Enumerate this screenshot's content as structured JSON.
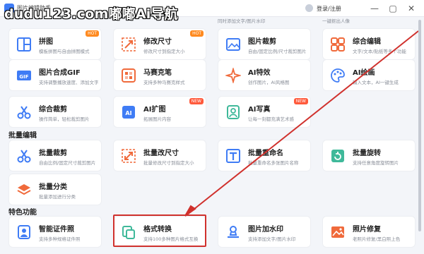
{
  "titlebar": {
    "app_title": "图片编辑助手",
    "watermark": "dudu123.com嘟嘟Ai导航",
    "login": "登录/注册",
    "minimize": "—",
    "maximize": "▢",
    "close": "✕"
  },
  "top_cut_descs": [
    "",
    "",
    "同时添加文字/图片水印",
    "一键抠出人像"
  ],
  "sections": {
    "batch": "批量编辑",
    "special": "特色功能"
  },
  "tools": {
    "pintu": {
      "title": "拼图",
      "desc": "模板拼图与自由拼图模式",
      "badge": "HOT"
    },
    "resize": {
      "title": "修改尺寸",
      "desc": "修改尺寸到指定大小",
      "badge": "HOT"
    },
    "crop": {
      "title": "图片裁剪",
      "desc": "自由/固定比例/尺寸裁剪图片"
    },
    "composite": {
      "title": "综合编辑",
      "desc": "文字/文本/贴纸等多个功能"
    },
    "gif": {
      "title": "图片合成GIF",
      "desc": "支持调整播放速度、添加文字"
    },
    "mosaic": {
      "title": "马赛克笔",
      "desc": "支持多种马赛克样式"
    },
    "ai_effect": {
      "title": "AI特效",
      "desc": "创作图片，AI风格图"
    },
    "ai_paint": {
      "title": "AI绘画",
      "desc": "输入文本，AI一键生成"
    },
    "comp_cut": {
      "title": "综合裁剪",
      "desc": "操作简单，轻松裁剪图片"
    },
    "ai_expand": {
      "title": "AI扩图",
      "desc": "拓展图片内容",
      "badge": "NEW"
    },
    "ai_portrait": {
      "title": "AI写真",
      "desc": "让每一刻都充满艺术感",
      "badge": "NEW"
    },
    "batch_crop": {
      "title": "批量裁剪",
      "desc": "自由比例/固定尺寸裁剪图片"
    },
    "batch_resize": {
      "title": "批量改尺寸",
      "desc": "批量修改尺寸到指定大小"
    },
    "batch_rename": {
      "title": "批量重命名",
      "desc": "批量重命名多张图片名称"
    },
    "batch_rotate": {
      "title": "批量旋转",
      "desc": "支持任意角度旋转图片"
    },
    "batch_classify": {
      "title": "批量分类",
      "desc": "批量添加进行分类"
    },
    "id_photo": {
      "title": "智能证件照",
      "desc": "支持多种规格证件照"
    },
    "format": {
      "title": "格式转换",
      "desc": "支持100多种图片格式互换"
    },
    "watermark_add": {
      "title": "图片加水印",
      "desc": "支持添加文字/图片水印"
    },
    "repair": {
      "title": "照片修复",
      "desc": "老照片修复/黑白照上色"
    }
  },
  "colors": {
    "accent": "#3f7cf5",
    "highlight": "#d0312d",
    "hot": "#ff8a1f",
    "new": "#ff5a3c"
  }
}
